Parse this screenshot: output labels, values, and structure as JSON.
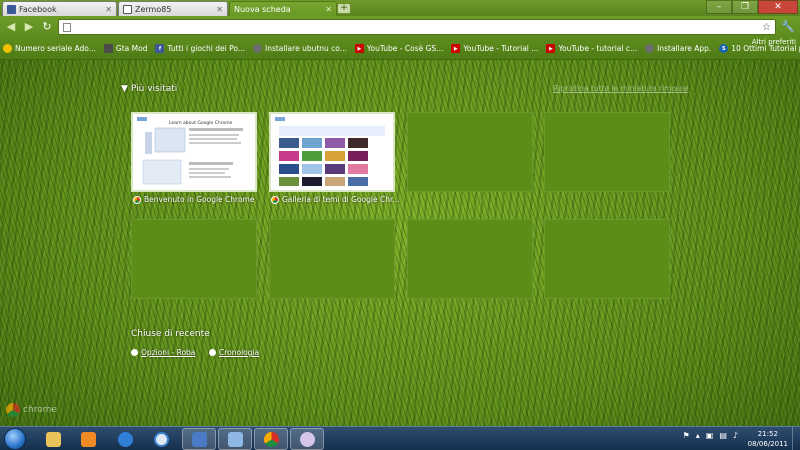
{
  "tabs": [
    {
      "label": "Facebook",
      "favicon_color": "#3b5998",
      "active": false
    },
    {
      "label": "Zermo85",
      "favicon_color": "#ffffff",
      "active": false
    },
    {
      "label": "Nuova scheda",
      "favicon_color": "",
      "active": true
    }
  ],
  "toolbar": {
    "back_icon": "back-arrow-icon",
    "forward_icon": "forward-arrow-icon",
    "reload_icon": "reload-icon",
    "omnibox_value": "",
    "bookmark_icon": "star-icon",
    "menu_icon": "wrench-icon"
  },
  "bookmarks": [
    {
      "label": "Numero seriale Ado...",
      "icon": "smiley-icon",
      "color": "#f2c200"
    },
    {
      "label": "Gta Mod",
      "icon": "gta-icon",
      "color": "#4b4b4b"
    },
    {
      "label": "Tutti i giochi dei Po...",
      "icon": "facebook-icon",
      "color": "#3b5998"
    },
    {
      "label": "Installare ubutnu co...",
      "icon": "mic-icon",
      "color": "#6d6d6d"
    },
    {
      "label": "YouTube - Cosè GS...",
      "icon": "youtube-icon",
      "color": "#cc0000"
    },
    {
      "label": "YouTube - Tutorial ...",
      "icon": "youtube-icon",
      "color": "#cc0000"
    },
    {
      "label": "YouTube - tutorial c...",
      "icon": "youtube-icon",
      "color": "#cc0000"
    },
    {
      "label": "Installare App.",
      "icon": "mic-icon",
      "color": "#6d6d6d"
    },
    {
      "label": "10 Ottimi Tutorial p...",
      "icon": "s-icon",
      "color": "#1a66b3"
    }
  ],
  "bookmarks_more": "Altri preferiti",
  "most_visited": {
    "title": "Più visitati",
    "restore_link": "Ripristina tutte le miniature rimosse",
    "items": [
      {
        "title": "Benvenuto in Google Chrome",
        "page_heading": "Learn about Google Chrome"
      },
      {
        "title": "Galleria di temi di Google Chr...",
        "page_heading": ""
      }
    ]
  },
  "recently_closed": {
    "title": "Chiuse di recente",
    "items": [
      {
        "label": "Opzioni - Roba",
        "icon": "wrench-icon"
      },
      {
        "label": "Cronologia",
        "icon": "clock-icon"
      }
    ]
  },
  "chrome_brand": "chrome",
  "taskbar": {
    "clock_time": "21:52",
    "clock_date": "08/06/2011",
    "apps": [
      "explorer-icon",
      "media-player-icon",
      "internet-explorer-icon",
      "itunes-icon",
      "app-icon",
      "network-icon",
      "chrome-icon",
      "paint-icon"
    ]
  }
}
